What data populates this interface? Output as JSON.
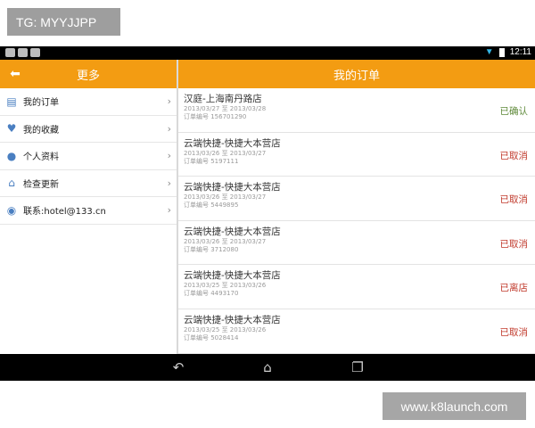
{
  "overlay_badge": "TG: MYYJJPP",
  "watermark": "www.k8launch.com",
  "status_bar": {
    "time": "12:11"
  },
  "sidebar": {
    "title": "更多",
    "items": [
      {
        "label": "我的订单",
        "icon": "document-icon"
      },
      {
        "label": "我的收藏",
        "icon": "heart-icon"
      },
      {
        "label": "个人资料",
        "icon": "person-icon"
      },
      {
        "label": "检查更新",
        "icon": "home-icon"
      },
      {
        "label": "联系:hotel@133.cn",
        "icon": "chat-icon"
      }
    ]
  },
  "orders": {
    "title": "我的订单",
    "list": [
      {
        "hotel": "汉庭-上海南丹路店",
        "dates": "2013/03/27 至 2013/03/28",
        "order_no": "订单编号 156701290",
        "status": "已确认",
        "status_type": "confirmed"
      },
      {
        "hotel": "云端快捷-快捷大本营店",
        "dates": "2013/03/26 至 2013/03/27",
        "order_no": "订单编号 5197111",
        "status": "已取消",
        "status_type": "cancelled"
      },
      {
        "hotel": "云端快捷-快捷大本营店",
        "dates": "2013/03/26 至 2013/03/27",
        "order_no": "订单编号 5449895",
        "status": "已取消",
        "status_type": "cancelled"
      },
      {
        "hotel": "云端快捷-快捷大本营店",
        "dates": "2013/03/26 至 2013/03/27",
        "order_no": "订单编号 3712080",
        "status": "已取消",
        "status_type": "cancelled"
      },
      {
        "hotel": "云端快捷-快捷大本营店",
        "dates": "2013/03/25 至 2013/03/26",
        "order_no": "订单编号 4493170",
        "status": "已离店",
        "status_type": "cancelled"
      },
      {
        "hotel": "云端快捷-快捷大本营店",
        "dates": "2013/03/25 至 2013/03/26",
        "order_no": "订单编号 5028414",
        "status": "已取消",
        "status_type": "cancelled"
      }
    ]
  },
  "colors": {
    "accent": "#f39c12",
    "confirmed": "#5f8a3a",
    "cancelled": "#c0392b"
  },
  "icons": {
    "back": "back-arrow-icon",
    "chevron": "chevron-right-icon",
    "nav_back": "nav-back-icon",
    "nav_home": "nav-home-icon",
    "nav_recent": "nav-recent-apps-icon"
  }
}
